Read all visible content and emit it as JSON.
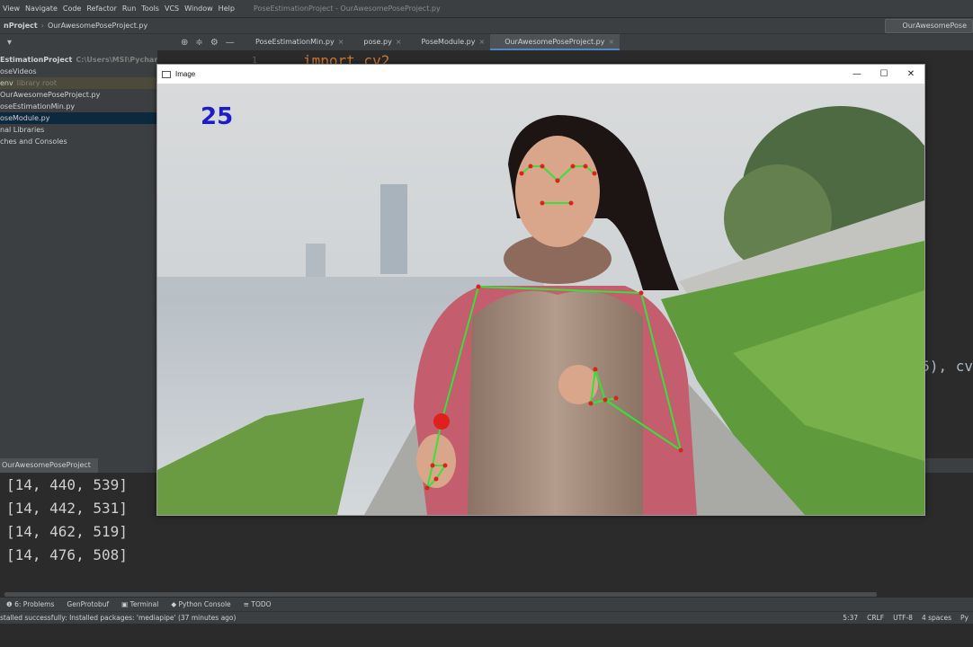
{
  "ide": {
    "menu": [
      "View",
      "Navigate",
      "Code",
      "Refactor",
      "Run",
      "Tools",
      "VCS",
      "Window",
      "Help"
    ],
    "title": "PoseEstimationProject - OurAwesomePoseProject.py",
    "breadcrumb": [
      "nProject",
      "OurAwesomePoseProject.py"
    ],
    "run_config": "OurAwesomePose"
  },
  "tabs": [
    {
      "label": "PoseEstimationMin.py",
      "active": false
    },
    {
      "label": "pose.py",
      "active": false
    },
    {
      "label": "PoseModule.py",
      "active": false
    },
    {
      "label": "OurAwesomePoseProject.py",
      "active": true
    }
  ],
  "project_tree": [
    {
      "label": "EstimationProject",
      "hint": "C:\\Users\\MSI\\PycharmProjects\\PoseEstimationProject",
      "bold": true
    },
    {
      "label": "oseVideos"
    },
    {
      "label": "env",
      "hint": "library root",
      "venv": true
    },
    {
      "label": "OurAwesomePoseProject.py"
    },
    {
      "label": "oseEstimationMin.py"
    },
    {
      "label": "oseModule.py",
      "selected": true
    },
    {
      "label": "nal Libraries"
    },
    {
      "label": "ches and Consoles"
    }
  ],
  "editor": {
    "gutter_line": "1",
    "peek_code": "import cv2",
    "peek_right": "5), cv"
  },
  "run_tab": "OurAwesomePoseProject",
  "console_lines": [
    "[14, 440, 539]",
    "[14, 442, 531]",
    "[14, 462, 519]",
    "[14, 476, 508]"
  ],
  "bottom_tabs": [
    "6: Problems",
    "GenProtobuf",
    "Terminal",
    "Python Console",
    "TODO"
  ],
  "status": {
    "message": "stalled successfully: Installed packages: 'mediapipe' (37 minutes ago)",
    "position": "5:37",
    "line_sep": "CRLF",
    "encoding": "UTF-8",
    "indent": "4 spaces",
    "interpreter": "Py"
  },
  "cv_window": {
    "title": "Image",
    "fps": "25",
    "fps_color": "#1c1cc8",
    "landmark_color": "#e0201a",
    "connection_color": "#36e23a"
  }
}
